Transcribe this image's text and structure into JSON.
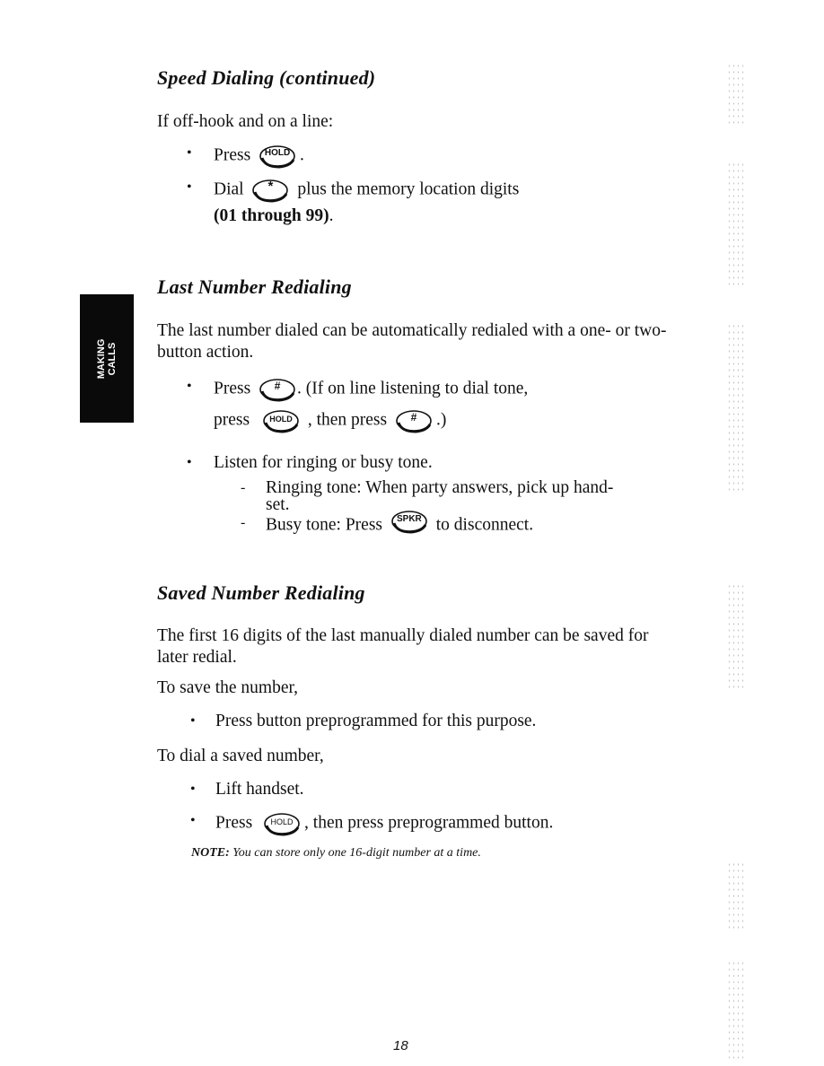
{
  "side_tab": {
    "line1": "MAKING",
    "line2": "CALLS"
  },
  "speed_dialing": {
    "heading": "Speed Dialing (continued)",
    "intro": "If off-hook and on a line:",
    "steps": [
      {
        "before": "Press",
        "key": "HOLD",
        "after": "."
      },
      {
        "before": "Dial",
        "key": "*",
        "after": "plus the memory location digits",
        "continuation": "(01 through 99)",
        "continuation_end": "."
      }
    ]
  },
  "last_number_redialing": {
    "heading": "Last Number Redialing",
    "intro": "The last number dialed can be automatically redialed with a one- or two-button action.",
    "step1": {
      "before": "Press",
      "key": "#",
      "after": ". (If on line listening to dial tone,",
      "line2_before": "press",
      "line2_key": "HOLD",
      "line2_mid": ", then press",
      "line2_key2": "#",
      "line2_after": ".)"
    },
    "step2": "Listen for ringing or busy tone.",
    "sub_items": [
      {
        "text": "Ringing tone: When party answers, pick up hand-",
        "continuation": "set."
      },
      {
        "before": "Busy tone: Press",
        "key": "SPKR",
        "after": "to disconnect."
      }
    ]
  },
  "saved_number_redialing": {
    "heading": "Saved Number Redialing",
    "intro": "The first 16 digits of the last manually dialed number can be saved for later redial.",
    "save_label": "To save the number,",
    "save_step": "Press button preprogrammed for this purpose.",
    "dial_label": "To dial a saved number,",
    "dial_steps": [
      {
        "text": "Lift handset."
      },
      {
        "before": "Press",
        "key": "HOLD",
        "after": ", then press preprogrammed button."
      }
    ],
    "note_label": "NOTE:",
    "note_text": "You can store only one 16-digit number at a time."
  },
  "page_number": "18",
  "bullet_glyph": "•",
  "dash_glyph": "-"
}
